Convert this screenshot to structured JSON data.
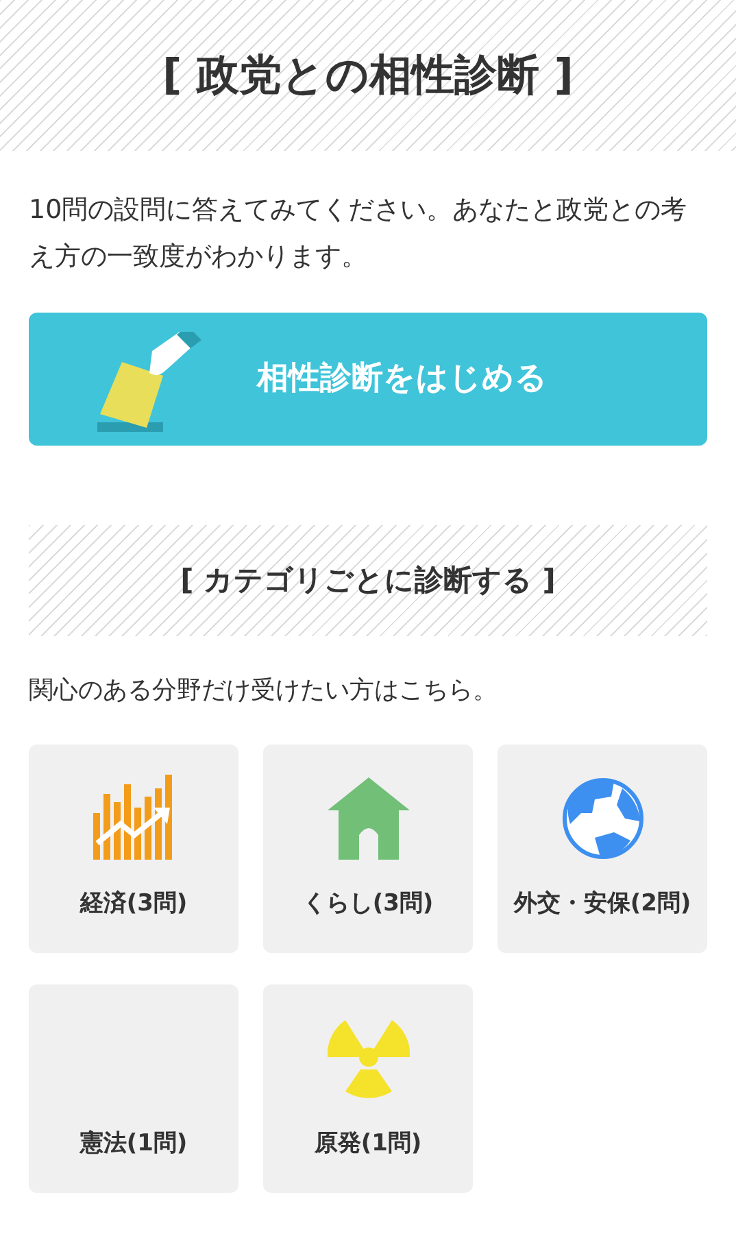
{
  "header": {
    "title": "[ 政党との相性診断 ]"
  },
  "intro": "10問の設問に答えてみてください。あなたと政党との考え方の一致度がわかります。",
  "start_button": {
    "label": "相性診断をはじめる"
  },
  "category_section": {
    "title": "[ カテゴリごとに診断する ]",
    "subtitle": "関心のある分野だけ受けたい方はこちら。"
  },
  "categories": [
    {
      "label": "経済(3問)",
      "kind": "chart"
    },
    {
      "label": "くらし(3問)",
      "kind": "house"
    },
    {
      "label": "外交・安保(2問)",
      "kind": "globe"
    },
    {
      "label": "憲法(1問)",
      "kind": "blank"
    },
    {
      "label": "原発(1問)",
      "kind": "radiation"
    }
  ]
}
